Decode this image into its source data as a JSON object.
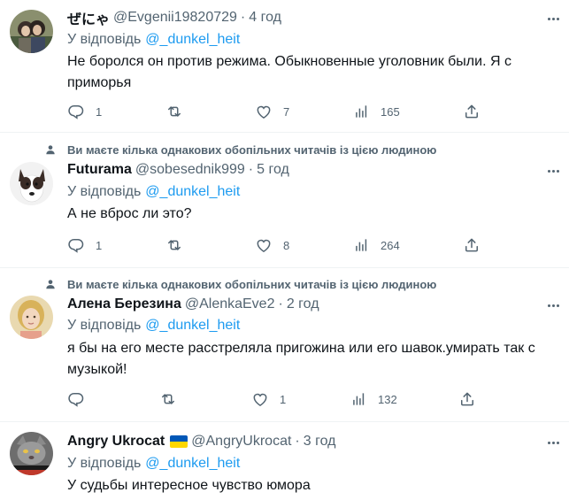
{
  "tweets": [
    {
      "social_context": "",
      "name": "ぜにゃ",
      "handle": "@Evgenii19820729",
      "time": "4 год",
      "reply_label": "У відповідь",
      "reply_to": "@_dunkel_heit",
      "text": "Не боролся он против режима. Обыкновенные уголовник были. Я с приморья",
      "replies": "1",
      "retweets": "",
      "likes": "7",
      "views": "165"
    },
    {
      "social_context": "Ви маєте кілька однакових обопільних читачів із цією людиною",
      "name": "Futurama",
      "handle": "@sobesednik999",
      "time": "5 год",
      "reply_label": "У відповідь",
      "reply_to": "@_dunkel_heit",
      "text": "А не вброс ли это?",
      "replies": "1",
      "retweets": "",
      "likes": "8",
      "views": "264"
    },
    {
      "social_context": "Ви маєте кілька однакових обопільних читачів із цією людиною",
      "name": "Алена Березина",
      "handle": "@AlenkaEve2",
      "time": "2 год",
      "reply_label": "У відповідь",
      "reply_to": "@_dunkel_heit",
      "text": "я бы на его месте расстреляла пригожина или его шавок.умирать так с музыкой!",
      "replies": "",
      "retweets": "",
      "likes": "1",
      "views": "132"
    },
    {
      "social_context": "",
      "name": "Angry Ukrocat",
      "handle": "@AngryUkrocat",
      "time": "3 год",
      "reply_label": "У відповідь",
      "reply_to": "@_dunkel_heit",
      "text": "У судьбы интересное чувство юмора"
    }
  ],
  "separator": "·",
  "colors": {
    "accent": "#1d9bf0",
    "muted": "#536471",
    "text": "#0f1419",
    "divider": "#eff3f4"
  }
}
